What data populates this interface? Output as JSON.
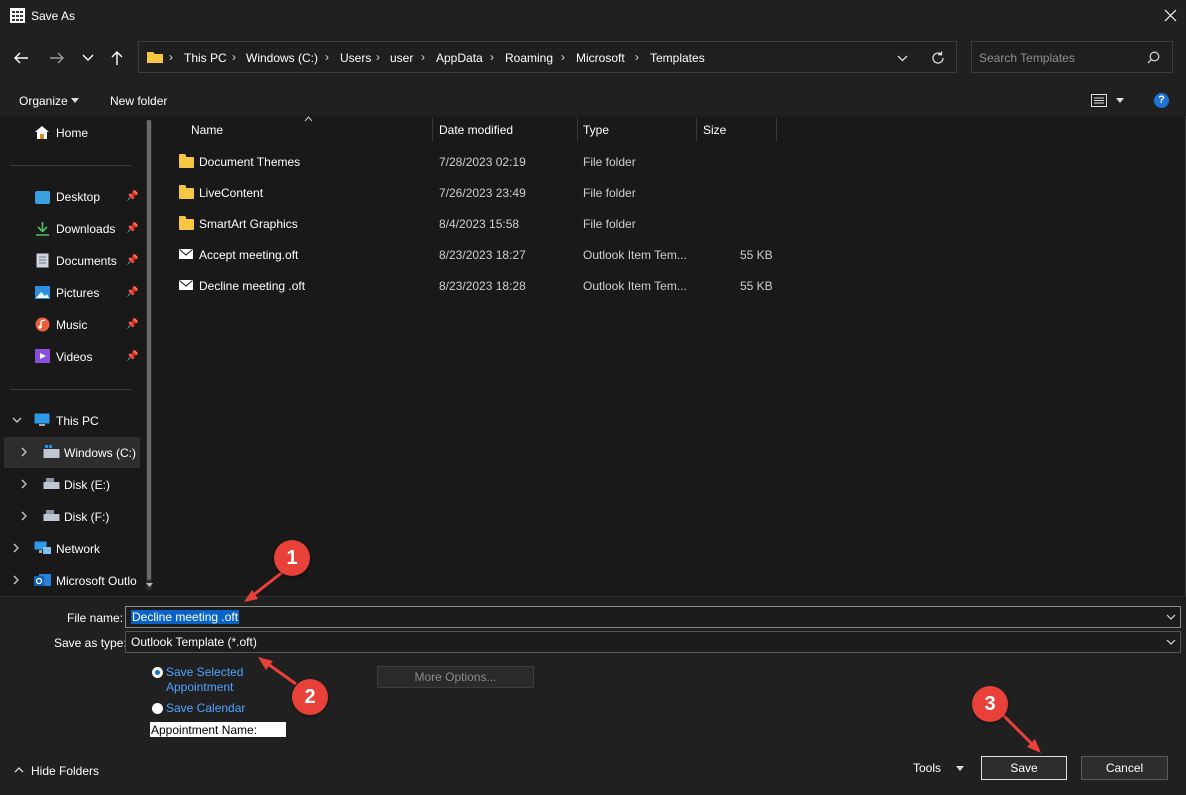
{
  "window": {
    "title": "Save As"
  },
  "address": {
    "crumbs": [
      "This PC",
      "Windows (C:)",
      "Users",
      "user",
      "AppData",
      "Roaming",
      "Microsoft",
      "Templates"
    ]
  },
  "search": {
    "placeholder": "Search Templates"
  },
  "toolbar": {
    "organize_label": "Organize",
    "new_folder_label": "New folder",
    "help_label": "?"
  },
  "sidebar": {
    "home": "Home",
    "quick": [
      {
        "label": "Desktop"
      },
      {
        "label": "Downloads"
      },
      {
        "label": "Documents"
      },
      {
        "label": "Pictures"
      },
      {
        "label": "Music"
      },
      {
        "label": "Videos"
      }
    ],
    "this_pc": "This PC",
    "drives": [
      {
        "label": "Windows (C:)"
      },
      {
        "label": "Disk (E:)"
      },
      {
        "label": "Disk (F:)"
      }
    ],
    "network": "Network",
    "outlook": "Microsoft Outlo"
  },
  "columns": {
    "name": "Name",
    "date": "Date modified",
    "type": "Type",
    "size": "Size"
  },
  "files": [
    {
      "name": "Document Themes",
      "date": "7/28/2023 02:19",
      "type": "File folder",
      "size": "",
      "kind": "folder"
    },
    {
      "name": "LiveContent",
      "date": "7/26/2023 23:49",
      "type": "File folder",
      "size": "",
      "kind": "folder"
    },
    {
      "name": "SmartArt Graphics",
      "date": "8/4/2023 15:58",
      "type": "File folder",
      "size": "",
      "kind": "folder"
    },
    {
      "name": "Accept meeting.oft",
      "date": "8/23/2023 18:27",
      "type": "Outlook Item Tem...",
      "size": "55 KB",
      "kind": "mail"
    },
    {
      "name": "Decline meeting .oft",
      "date": "8/23/2023 18:28",
      "type": "Outlook Item Tem...",
      "size": "55 KB",
      "kind": "mail"
    }
  ],
  "form": {
    "file_name_label": "File name:",
    "file_name_value": "Decline meeting .oft",
    "save_type_label": "Save as type:",
    "save_type_value": "Outlook Template (*.oft)",
    "radio_selected": "Save Selected Appointment",
    "radio_selected_line1": "Save Selected",
    "radio_selected_line2": "Appointment",
    "radio_calendar": "Save Calendar",
    "appointment_name": "Appointment Name:",
    "more_options": "More Options..."
  },
  "footer": {
    "hide_folders": "Hide Folders",
    "tools": "Tools",
    "save": "Save",
    "cancel": "Cancel"
  },
  "callouts": [
    "1",
    "2",
    "3"
  ],
  "colors": {
    "accent": "#4ea3ff",
    "callout": "#e8413a",
    "folder": "#f7c744"
  }
}
